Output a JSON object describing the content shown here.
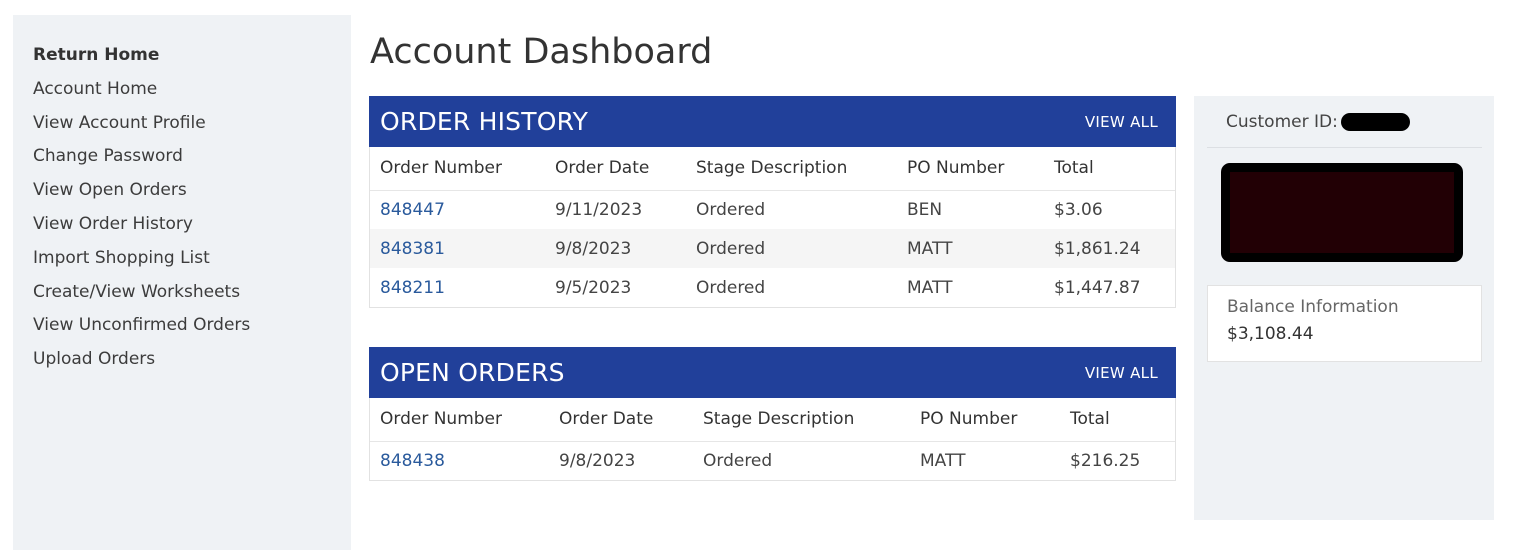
{
  "sidebar": {
    "items": [
      {
        "label": "Return Home"
      },
      {
        "label": "Account Home"
      },
      {
        "label": "View Account Profile"
      },
      {
        "label": "Change Password"
      },
      {
        "label": "View Open Orders"
      },
      {
        "label": "View Order History"
      },
      {
        "label": "Import Shopping List"
      },
      {
        "label": "Create/View Worksheets"
      },
      {
        "label": "View Unconfirmed Orders"
      },
      {
        "label": "Upload Orders"
      }
    ]
  },
  "page_title": "Account Dashboard",
  "order_history": {
    "title": "ORDER HISTORY",
    "view_all": "VIEW ALL",
    "columns": [
      "Order Number",
      "Order Date",
      "Stage Description",
      "PO Number",
      "Total"
    ],
    "rows": [
      [
        "848447",
        "9/11/2023",
        "Ordered",
        "BEN",
        "$3.06"
      ],
      [
        "848381",
        "9/8/2023",
        "Ordered",
        "MATT",
        "$1,861.24"
      ],
      [
        "848211",
        "9/5/2023",
        "Ordered",
        "MATT",
        "$1,447.87"
      ]
    ]
  },
  "open_orders": {
    "title": "OPEN ORDERS",
    "view_all": "VIEW ALL",
    "columns": [
      "Order Number",
      "Order Date",
      "Stage Description",
      "PO Number",
      "Total"
    ],
    "rows": [
      [
        "848438",
        "9/8/2023",
        "Ordered",
        "MATT",
        "$216.25"
      ]
    ]
  },
  "account": {
    "customer_id_label": "Customer ID:",
    "balance_label": "Balance Information",
    "balance_value": "$3,108.44"
  },
  "colors": {
    "header_blue": "#21409a",
    "link_blue": "#2a5a9c",
    "panel_bg": "#eff2f5"
  }
}
